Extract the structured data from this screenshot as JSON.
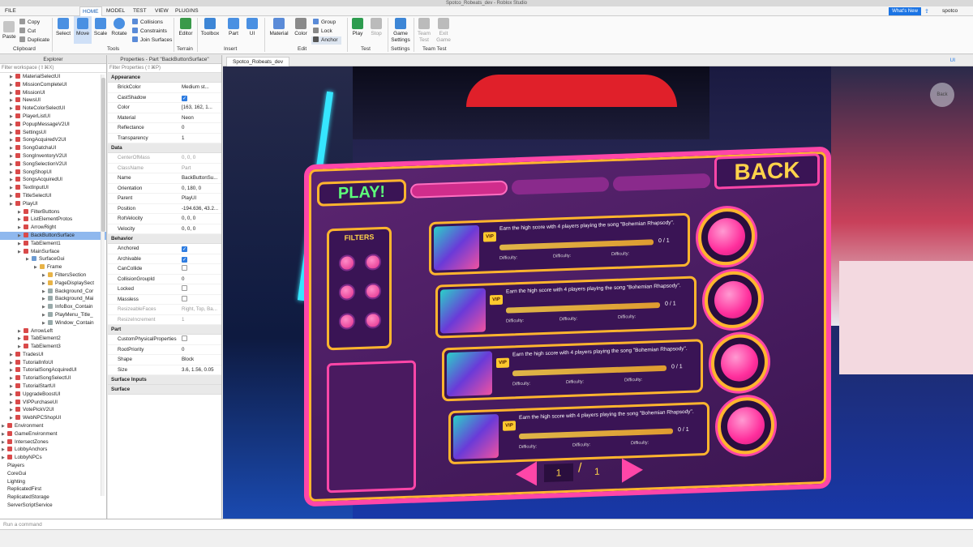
{
  "window": {
    "title": "Spotco_Robeats_dev - Roblox Studio"
  },
  "menu": {
    "items": [
      "FILE",
      "HOME",
      "MODEL",
      "TEST",
      "VIEW",
      "PLUGINS"
    ],
    "active": "HOME",
    "whats_new": "What's New",
    "user": "spotco"
  },
  "ribbon": {
    "clipboard": {
      "paste": "Paste",
      "copy": "Copy",
      "cut": "Cut",
      "duplicate": "Duplicate",
      "group": "Clipboard"
    },
    "tools": {
      "select": "Select",
      "move": "Move",
      "scale": "Scale",
      "rotate": "Rotate",
      "collisions": "Collisions",
      "constraints": "Constraints",
      "join": "Join Surfaces",
      "group": "Tools"
    },
    "terrain": {
      "editor": "Editor",
      "group": "Terrain"
    },
    "insert": {
      "toolbox": "Toolbox",
      "part": "Part",
      "ui": "UI",
      "group": "Insert"
    },
    "edit": {
      "material": "Material",
      "color": "Color",
      "group_btn": "Group",
      "lock": "Lock",
      "anchor": "Anchor",
      "group": "Edit"
    },
    "test": {
      "play": "Play",
      "stop": "Stop",
      "group": "Test"
    },
    "settings": {
      "game": "Game Settings",
      "group": "Settings"
    },
    "teamtest": {
      "team": "Team Test",
      "exit": "Exit Game",
      "group": "Team Test"
    }
  },
  "explorer": {
    "title": "Explorer",
    "filter": "Filter workspace (⇧⌘X)",
    "items": [
      {
        "label": "MaterialSelectUI",
        "depth": 1,
        "icon": "gui"
      },
      {
        "label": "MissionCompleteUI",
        "depth": 1,
        "icon": "gui"
      },
      {
        "label": "MissionUI",
        "depth": 1,
        "icon": "gui"
      },
      {
        "label": "NewsUI",
        "depth": 1,
        "icon": "gui"
      },
      {
        "label": "NoteColorSelectUI",
        "depth": 1,
        "icon": "gui"
      },
      {
        "label": "PlayerListUI",
        "depth": 1,
        "icon": "gui"
      },
      {
        "label": "PopupMessageV2UI",
        "depth": 1,
        "icon": "gui"
      },
      {
        "label": "SettingsUI",
        "depth": 1,
        "icon": "gui"
      },
      {
        "label": "SongAcquiredV2UI",
        "depth": 1,
        "icon": "gui"
      },
      {
        "label": "SongGatchaUI",
        "depth": 1,
        "icon": "gui"
      },
      {
        "label": "SongInventoryV2UI",
        "depth": 1,
        "icon": "gui"
      },
      {
        "label": "SongSelectionV2UI",
        "depth": 1,
        "icon": "gui"
      },
      {
        "label": "SongShopUI",
        "depth": 1,
        "icon": "gui"
      },
      {
        "label": "SongsAcquiredUI",
        "depth": 1,
        "icon": "gui"
      },
      {
        "label": "TextInputUI",
        "depth": 1,
        "icon": "gui"
      },
      {
        "label": "TitleSelectUI",
        "depth": 1,
        "icon": "gui"
      },
      {
        "label": "PlayUI",
        "depth": 1,
        "icon": "gui"
      },
      {
        "label": "FilterButtons",
        "depth": 2,
        "icon": "gui"
      },
      {
        "label": "ListElementProtos",
        "depth": 2,
        "icon": "gui"
      },
      {
        "label": "ArrowRight",
        "depth": 2,
        "icon": "gui"
      },
      {
        "label": "BackButtonSurface",
        "depth": 2,
        "icon": "gui",
        "selected": true
      },
      {
        "label": "TabElement1",
        "depth": 2,
        "icon": "gui"
      },
      {
        "label": "MainSurface",
        "depth": 2,
        "icon": "gui"
      },
      {
        "label": "SurfaceGui",
        "depth": 3,
        "icon": "surf"
      },
      {
        "label": "Frame",
        "depth": 4,
        "icon": "frame"
      },
      {
        "label": "FiltersSection",
        "depth": 5,
        "icon": "frame"
      },
      {
        "label": "PageDisplaySect",
        "depth": 5,
        "icon": "frame"
      },
      {
        "label": "Background_Cor",
        "depth": 5,
        "icon": "plain"
      },
      {
        "label": "Background_Mai",
        "depth": 5,
        "icon": "plain"
      },
      {
        "label": "InfoBox_Contain",
        "depth": 5,
        "icon": "plain"
      },
      {
        "label": "PlayMenu_Title_",
        "depth": 5,
        "icon": "plain"
      },
      {
        "label": "Window_Contain",
        "depth": 5,
        "icon": "plain"
      },
      {
        "label": "ArrowLeft",
        "depth": 2,
        "icon": "gui"
      },
      {
        "label": "TabElement2",
        "depth": 2,
        "icon": "gui"
      },
      {
        "label": "TabElement3",
        "depth": 2,
        "icon": "gui"
      },
      {
        "label": "TradesUI",
        "depth": 1,
        "icon": "gui"
      },
      {
        "label": "TutorialInfoUI",
        "depth": 1,
        "icon": "gui"
      },
      {
        "label": "TutorialSongAcquiredUI",
        "depth": 1,
        "icon": "gui"
      },
      {
        "label": "TutorialSongSelectUI",
        "depth": 1,
        "icon": "gui"
      },
      {
        "label": "TutorialStartUI",
        "depth": 1,
        "icon": "gui"
      },
      {
        "label": "UpgradeBoostUI",
        "depth": 1,
        "icon": "gui"
      },
      {
        "label": "VIPPurchaseUI",
        "depth": 1,
        "icon": "gui"
      },
      {
        "label": "VotePickV2UI",
        "depth": 1,
        "icon": "gui"
      },
      {
        "label": "WebNPCShopUI",
        "depth": 1,
        "icon": "gui"
      },
      {
        "label": "Environment",
        "depth": 0,
        "icon": "gui"
      },
      {
        "label": "GameEnvironment",
        "depth": 0,
        "icon": "gui"
      },
      {
        "label": "IntersectZones",
        "depth": 0,
        "icon": "gui"
      },
      {
        "label": "LobbyAnchors",
        "depth": 0,
        "icon": "gui"
      },
      {
        "label": "LobbyNPCs",
        "depth": 0,
        "icon": "gui"
      },
      {
        "label": "Players",
        "depth": 0,
        "icon": "none"
      },
      {
        "label": "CoreGui",
        "depth": 0,
        "icon": "none"
      },
      {
        "label": "Lighting",
        "depth": 0,
        "icon": "none"
      },
      {
        "label": "ReplicatedFirst",
        "depth": 0,
        "icon": "none"
      },
      {
        "label": "ReplicatedStorage",
        "depth": 0,
        "icon": "none"
      },
      {
        "label": "ServerScriptService",
        "depth": 0,
        "icon": "none"
      }
    ]
  },
  "properties": {
    "title": "Properties - Part \"BackButtonSurface\"",
    "filter": "Filter Properties (⇧⌘P)",
    "sections": [
      {
        "name": "Appearance",
        "rows": [
          {
            "k": "BrickColor",
            "v": "Medium st..."
          },
          {
            "k": "CastShadow",
            "check": true
          },
          {
            "k": "Color",
            "v": "[163, 162, 1..."
          },
          {
            "k": "Material",
            "v": "Neon"
          },
          {
            "k": "Reflectance",
            "v": "0"
          },
          {
            "k": "Transparency",
            "v": "1"
          }
        ]
      },
      {
        "name": "Data",
        "rows": [
          {
            "k": "CenterOfMass",
            "v": "0, 0, 0",
            "dim": true
          },
          {
            "k": "ClassName",
            "v": "Part",
            "dim": true
          },
          {
            "k": "Name",
            "v": "BackButtonSu..."
          },
          {
            "k": "Orientation",
            "v": "0, 180, 0"
          },
          {
            "k": "Parent",
            "v": "PlayUI"
          },
          {
            "k": "Position",
            "v": "-194.636, 43.2..."
          },
          {
            "k": "RotVelocity",
            "v": "0, 0, 0"
          },
          {
            "k": "Velocity",
            "v": "0, 0, 0"
          }
        ]
      },
      {
        "name": "Behavior",
        "rows": [
          {
            "k": "Anchored",
            "check": true
          },
          {
            "k": "Archivable",
            "check": true
          },
          {
            "k": "CanCollide",
            "check": false
          },
          {
            "k": "CollisionGroupId",
            "v": "0"
          },
          {
            "k": "Locked",
            "check": false
          },
          {
            "k": "Massless",
            "check": false
          },
          {
            "k": "ResizeableFaces",
            "v": "Right, Top, Ba...",
            "dim": true
          },
          {
            "k": "ResizeIncrement",
            "v": "1",
            "dim": true
          }
        ]
      },
      {
        "name": "Part",
        "rows": [
          {
            "k": "CustomPhysicalProperties",
            "check": false
          },
          {
            "k": "RootPriority",
            "v": "0"
          },
          {
            "k": "Shape",
            "v": "Block"
          },
          {
            "k": "Size",
            "v": "3.6, 1.56, 0.05"
          }
        ]
      },
      {
        "name": "Surface Inputs",
        "rows": []
      },
      {
        "name": "Surface",
        "rows": []
      }
    ]
  },
  "viewport": {
    "tab": "Spotco_Robeats_dev",
    "ui_toggle": "UI",
    "back_hint": "Back"
  },
  "game_menu": {
    "play_title": "PLAY!",
    "back_title": "BACK",
    "filters_label": "FILTERS",
    "vip": "VIP",
    "missions": [
      {
        "text": "Earn the high score with 4 players playing the song \"Bohemian Rhapsody\".",
        "progress": "0 / 1",
        "fraction": 0.0
      },
      {
        "text": "Earn the high score with 4 players playing the song \"Bohemian Rhapsody\".",
        "progress": "0 / 1",
        "fraction": 0.0
      },
      {
        "text": "Earn the high score with 4 players playing the song \"Bohemian Rhapsody\".",
        "progress": "0 / 1",
        "fraction": 0.0
      },
      {
        "text": "Earn the high score with 4 players playing the song \"Bohemian Rhapsody\".",
        "progress": "0 / 1",
        "fraction": 0.0
      }
    ],
    "difficulty_label": "Difficulty:",
    "page_current": "1",
    "page_sep": "/",
    "page_total": "1"
  },
  "command_bar": {
    "placeholder": "Run a command"
  },
  "colors": {
    "accent": "#1b74e4",
    "menu_border": "#ff46a8",
    "menu_gold": "#ffb52e",
    "selection": "#8fb8ee"
  }
}
